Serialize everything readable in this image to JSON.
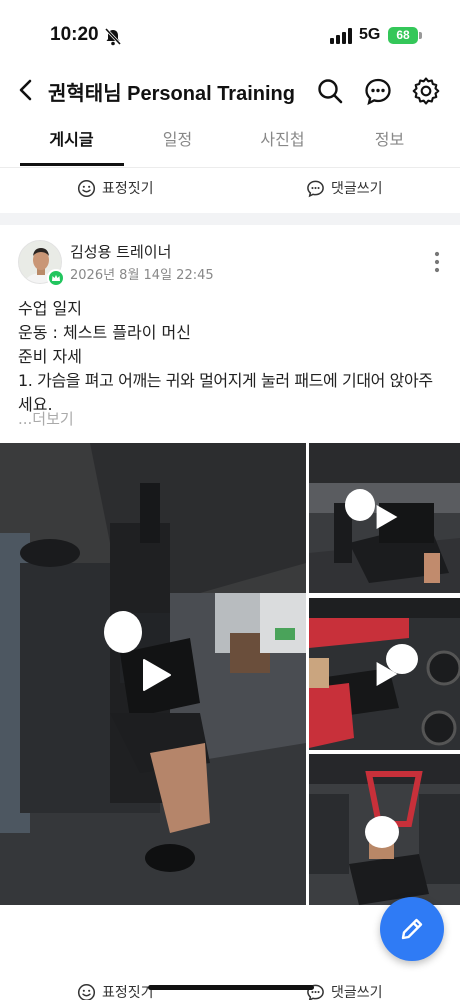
{
  "status_bar": {
    "time": "10:20",
    "network": "5G",
    "battery": "68"
  },
  "header": {
    "title": "권혁태님 Personal Training"
  },
  "tabs": [
    {
      "label": "게시글",
      "active": true
    },
    {
      "label": "일정",
      "active": false
    },
    {
      "label": "사진첩",
      "active": false
    },
    {
      "label": "정보",
      "active": false
    }
  ],
  "actions": {
    "react_label": "표정짓기",
    "comment_label": "댓글쓰기"
  },
  "post": {
    "author": "김성용 트레이너",
    "date": "2026년 8월 14일 22:45",
    "lines": [
      "수업 일지",
      "운동 : 체스트 플라이 머신",
      "준비 자세",
      "1. 가슴을 펴고 어깨는 귀와 멀어지게 눌러 패드에 기대어 앉아주",
      "세요."
    ],
    "see_more": "...더보기"
  },
  "colors": {
    "accent": "#2f7bf5",
    "badge": "#22c55e",
    "battery": "#34c759"
  }
}
